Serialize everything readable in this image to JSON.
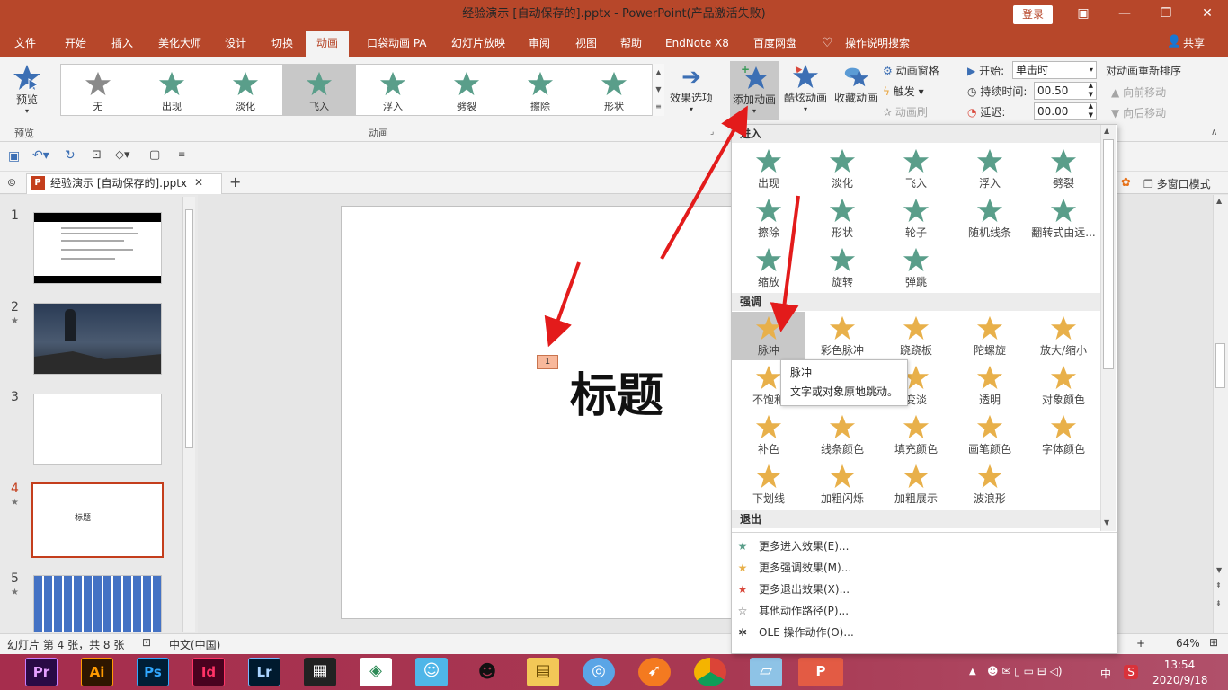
{
  "window": {
    "title": "经验演示 [自动保存的].pptx  -  PowerPoint(产品激活失败)",
    "login": "登录"
  },
  "tabs": [
    "文件",
    "开始",
    "插入",
    "美化大师",
    "设计",
    "切换",
    "动画",
    "口袋动画 PA",
    "幻灯片放映",
    "审阅",
    "视图",
    "帮助",
    "EndNote X8",
    "百度网盘",
    "操作说明搜索"
  ],
  "share": "共享",
  "ribbon": {
    "preview": "预览",
    "preview_group": "预览",
    "gallery": [
      "无",
      "出现",
      "淡化",
      "飞入",
      "浮入",
      "劈裂",
      "擦除",
      "形状"
    ],
    "effect_options": "效果选项",
    "animation_group": "动画",
    "add_animation": "添加动画",
    "cool_animation": "酷炫动画",
    "fav_animation": "收藏动画",
    "anim_pane": "动画窗格",
    "trigger": "触发",
    "anim_brush": "动画刷",
    "start_label": "开始:",
    "start_value": "单击时",
    "duration_label": "持续时间:",
    "duration_value": "00.50",
    "delay_label": "延迟:",
    "delay_value": "00.00",
    "reorder": "对动画重新排序",
    "move_earlier": "向前移动",
    "move_later": "向后移动"
  },
  "doc_tab": "经验演示 [自动保存的].pptx",
  "multi_window": "多窗口模式",
  "slides": [
    {
      "num": "1",
      "star": ""
    },
    {
      "num": "2",
      "star": "★"
    },
    {
      "num": "3",
      "star": ""
    },
    {
      "num": "4",
      "star": "★"
    },
    {
      "num": "5",
      "star": "★"
    }
  ],
  "thumb4_title": "标题",
  "slide": {
    "title": "标题",
    "badge": "1"
  },
  "dropdown": {
    "enter_head": "进入",
    "enter": [
      "出现",
      "淡化",
      "飞入",
      "浮入",
      "劈裂",
      "擦除",
      "形状",
      "轮子",
      "随机线条",
      "翻转式由远...",
      "缩放",
      "旋转",
      "弹跳"
    ],
    "emph_head": "强调",
    "emph": [
      "脉冲",
      "彩色脉冲",
      "跷跷板",
      "陀螺旋",
      "放大/缩小",
      "不饱和",
      "加深",
      "变淡",
      "透明",
      "对象颜色",
      "补色",
      "线条颜色",
      "填充颜色",
      "画笔颜色",
      "字体颜色",
      "下划线",
      "加粗闪烁",
      "加粗展示",
      "波浪形"
    ],
    "exit_head": "退出",
    "more_enter": "更多进入效果(E)...",
    "more_emph": "更多强调效果(M)...",
    "more_exit": "更多退出效果(X)...",
    "more_path": "其他动作路径(P)...",
    "ole": "OLE 操作动作(O)..."
  },
  "tooltip": {
    "title": "脉冲",
    "desc": "文字或对象原地跳动。"
  },
  "status": {
    "slide_info": "幻灯片 第 4 张，共 8 张",
    "lang": "中文(中国)",
    "zoom": "64%"
  },
  "taskbar": {
    "apps": [
      "Pr",
      "Ai",
      "Ps",
      "Id",
      "Lr"
    ],
    "time": "13:54",
    "date": "2020/9/18",
    "ime": "中"
  },
  "colors": {
    "accent": "#b7472a",
    "enter_star": "#5a9e8a",
    "emph_star": "#e8b04a",
    "exit_star": "#d9483b"
  }
}
